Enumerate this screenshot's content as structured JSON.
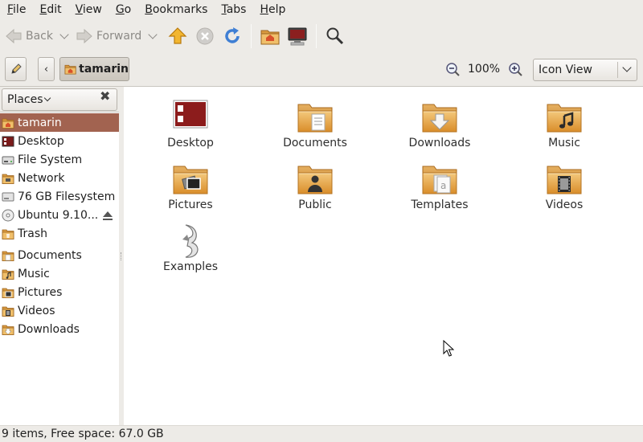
{
  "menubar": {
    "items": [
      {
        "mn": "F",
        "rest": "ile"
      },
      {
        "mn": "E",
        "rest": "dit"
      },
      {
        "mn": "V",
        "rest": "iew"
      },
      {
        "mn": "G",
        "rest": "o"
      },
      {
        "mn": "B",
        "rest": "ookmarks"
      },
      {
        "mn": "T",
        "rest": "abs"
      },
      {
        "mn": "H",
        "rest": "elp"
      }
    ]
  },
  "toolbar": {
    "back_label": "Back",
    "forward_label": "Forward"
  },
  "location": {
    "current_folder": "tamarin",
    "zoom_level": "100%",
    "view_mode": "Icon View"
  },
  "sidebar": {
    "header": "Places",
    "items": [
      {
        "label": "tamarin",
        "icon": "home-folder-icon"
      },
      {
        "label": "Desktop",
        "icon": "desktop-icon"
      },
      {
        "label": "File System",
        "icon": "harddisk-icon"
      },
      {
        "label": "Network",
        "icon": "network-icon"
      },
      {
        "label": "76 GB Filesystem",
        "icon": "drive-icon"
      },
      {
        "label": "Ubuntu 9.10...",
        "icon": "cdrom-icon"
      },
      {
        "label": "Trash",
        "icon": "trash-icon"
      }
    ],
    "bookmarks": [
      {
        "label": "Documents",
        "icon": "documents-folder-icon"
      },
      {
        "label": "Music",
        "icon": "music-folder-icon"
      },
      {
        "label": "Pictures",
        "icon": "pictures-folder-icon"
      },
      {
        "label": "Videos",
        "icon": "videos-folder-icon"
      },
      {
        "label": "Downloads",
        "icon": "downloads-folder-icon"
      }
    ]
  },
  "files": [
    {
      "label": "Desktop",
      "icon": "desktop-icon"
    },
    {
      "label": "Documents",
      "icon": "documents-folder-icon"
    },
    {
      "label": "Downloads",
      "icon": "downloads-folder-icon"
    },
    {
      "label": "Music",
      "icon": "music-folder-icon"
    },
    {
      "label": "Pictures",
      "icon": "pictures-folder-icon"
    },
    {
      "label": "Public",
      "icon": "public-folder-icon"
    },
    {
      "label": "Templates",
      "icon": "templates-folder-icon"
    },
    {
      "label": "Videos",
      "icon": "videos-folder-icon"
    },
    {
      "label": "Examples",
      "icon": "examples-link-icon"
    }
  ],
  "status": {
    "text": "9 items, Free space: 67.0 GB"
  },
  "colors": {
    "selection": "#a26350",
    "folder": "#e8a94a",
    "window_bg": "#edebe7"
  }
}
